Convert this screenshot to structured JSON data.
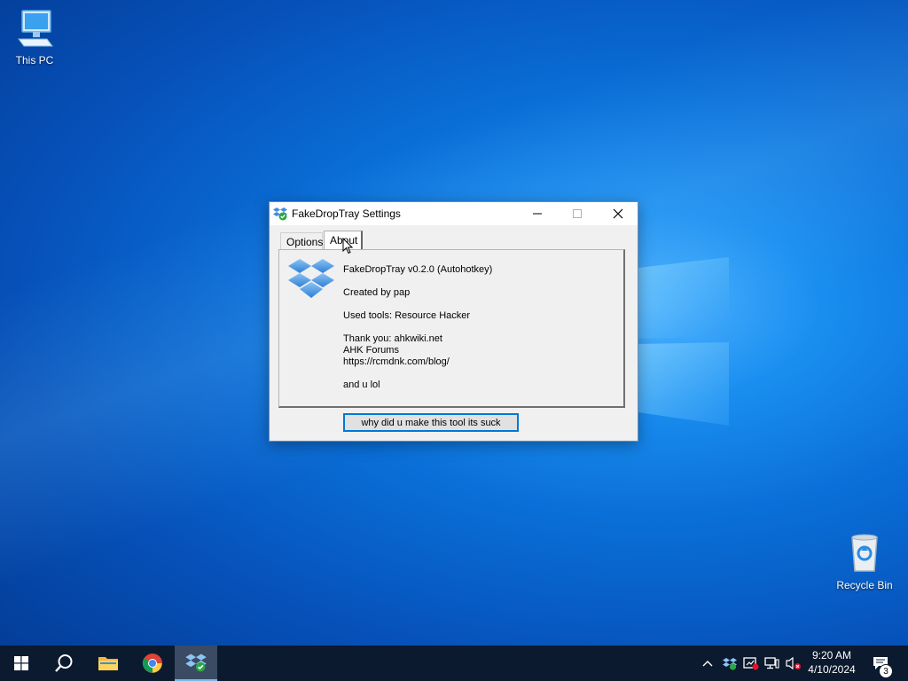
{
  "desktop": {
    "icons": [
      {
        "label": "This PC"
      },
      {
        "label": "Recycle Bin"
      }
    ]
  },
  "window": {
    "title": "FakeDropTray Settings",
    "tabs": [
      {
        "label": "Options",
        "selected": false
      },
      {
        "label": "About",
        "selected": true
      }
    ],
    "about": {
      "lines": [
        "FakeDropTray v0.2.0 (Autohotkey)",
        "Created by pap",
        "Used tools: Resource Hacker",
        "Thank you: ahkwiki.net",
        "AHK Forums",
        "https://rcmdnk.com/blog/",
        "and u lol"
      ]
    },
    "action_button": "why did u make this tool its suck"
  },
  "taskbar": {
    "clock_time": "9:20 AM",
    "clock_date": "4/10/2024",
    "notification_count": "3"
  },
  "colors": {
    "accent": "#0078d7",
    "taskbar": "#0b1a2e",
    "dropbox_blue": "#3d8fe0"
  }
}
